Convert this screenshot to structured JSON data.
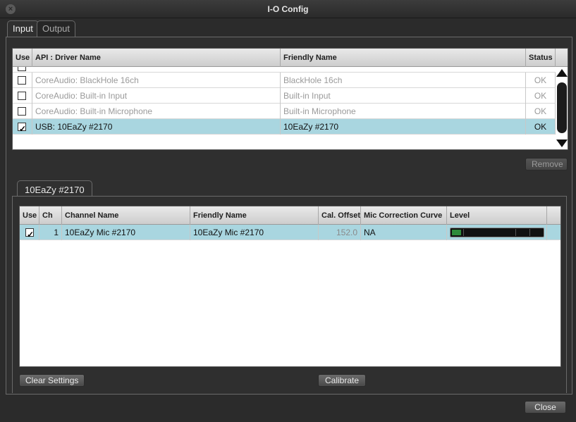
{
  "window": {
    "title": "I-O Config"
  },
  "tabs": [
    {
      "label": "Input",
      "active": true
    },
    {
      "label": "Output",
      "active": false
    }
  ],
  "drivers_table": {
    "headers": {
      "use": "Use",
      "api": "API : Driver Name",
      "friendly": "Friendly Name",
      "status": "Status"
    },
    "rows": [
      {
        "use": false,
        "api": "CoreAudio: BlackHole 16ch",
        "friendly": "BlackHole 16ch",
        "status": "OK",
        "selected": false
      },
      {
        "use": false,
        "api": "CoreAudio: Built-in Input",
        "friendly": "Built-in Input",
        "status": "OK",
        "selected": false
      },
      {
        "use": false,
        "api": "CoreAudio: Built-in Microphone",
        "friendly": "Built-in Microphone",
        "status": "OK",
        "selected": false
      },
      {
        "use": true,
        "api": "USB: 10EaZy #2170",
        "friendly": "10EaZy #2170",
        "status": "OK",
        "selected": true
      }
    ]
  },
  "remove_button": "Remove",
  "device_tab": {
    "label": "10EaZy #2170"
  },
  "channels_table": {
    "headers": {
      "use": "Use",
      "ch": "Ch",
      "channel_name": "Channel Name",
      "friendly": "Friendly Name",
      "cal_offset": "Cal. Offset",
      "mic_curve": "Mic Correction Curve",
      "level": "Level"
    },
    "rows": [
      {
        "use": true,
        "ch": "1",
        "channel_name": "10EaZy Mic #2170",
        "friendly": "10EaZy Mic #2170",
        "cal_offset": "152.0",
        "mic_curve": "NA",
        "level": 0.1
      }
    ]
  },
  "buttons": {
    "clear_settings": "Clear Settings",
    "calibrate": "Calibrate",
    "close": "Close"
  },
  "colors": {
    "selected_row": "#a9d6e0",
    "meter_fill": "#2e8b3a",
    "background": "#2b2b2b"
  }
}
